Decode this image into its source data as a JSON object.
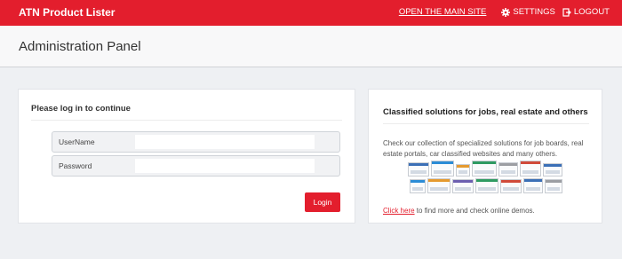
{
  "app": {
    "title": "ATN Product Lister",
    "nav": {
      "main_site": "OPEN THE MAIN SITE",
      "settings": "SETTINGS",
      "logout": "LOGOUT"
    }
  },
  "header": {
    "title": "Administration Panel"
  },
  "login": {
    "title": "Please log in to continue",
    "username_label": "UserName",
    "username_value": "",
    "password_label": "Password",
    "password_value": "",
    "button": "Login"
  },
  "info": {
    "title": "Classified solutions for jobs, real estate and others",
    "description": "Check our collection of specialized solutions for job boards, real estate portals, car classified websites and many others.",
    "link_text": "Click here",
    "link_suffix": " to find more and check online demos."
  },
  "colors": {
    "accent": "#e31e2d",
    "background": "#eef0f3"
  }
}
